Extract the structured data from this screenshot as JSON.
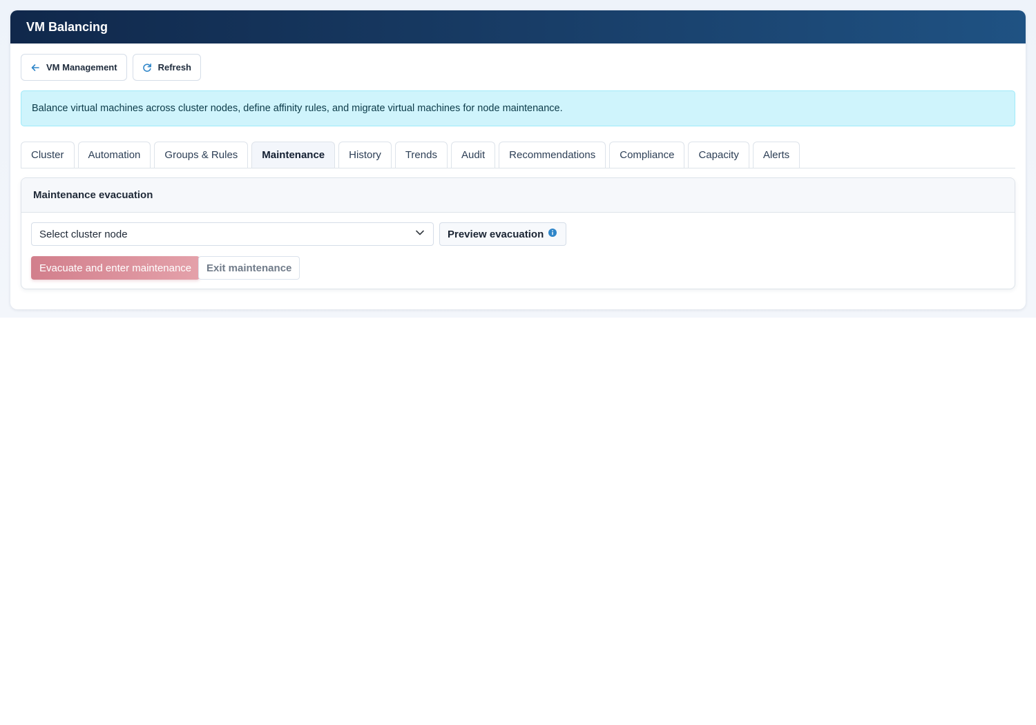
{
  "window": {
    "title": "VM Balancing"
  },
  "toolbar": {
    "back_label": "VM Management",
    "back_icon": "arrow-left-icon",
    "refresh_label": "Refresh",
    "refresh_icon": "refresh-icon"
  },
  "banner": {
    "text": "Balance virtual machines across cluster nodes, define affinity rules, and migrate virtual machines for node maintenance."
  },
  "tabs": [
    {
      "label": "Cluster",
      "active": false
    },
    {
      "label": "Automation",
      "active": false
    },
    {
      "label": "Groups & Rules",
      "active": false
    },
    {
      "label": "Maintenance",
      "active": true
    },
    {
      "label": "History",
      "active": false
    },
    {
      "label": "Trends",
      "active": false
    },
    {
      "label": "Audit",
      "active": false
    },
    {
      "label": "Recommendations",
      "active": false
    },
    {
      "label": "Compliance",
      "active": false
    },
    {
      "label": "Capacity",
      "active": false
    },
    {
      "label": "Alerts",
      "active": false
    }
  ],
  "maintenance": {
    "title": "Maintenance evacuation",
    "node_select": {
      "value": "Select cluster node",
      "icon": "chevron-down-icon"
    },
    "preview_label": "Preview evacuation",
    "preview_icon": "info-icon",
    "evacuate_label": "Evacuate and enter maintenance",
    "exit_label": "Exit maintenance"
  },
  "colors": {
    "header_start": "#10284b",
    "header_end": "#1f5283",
    "accent_icon": "#2f86c9",
    "info_bg": "#cff4fc",
    "danger_button": "#d27f8c"
  }
}
